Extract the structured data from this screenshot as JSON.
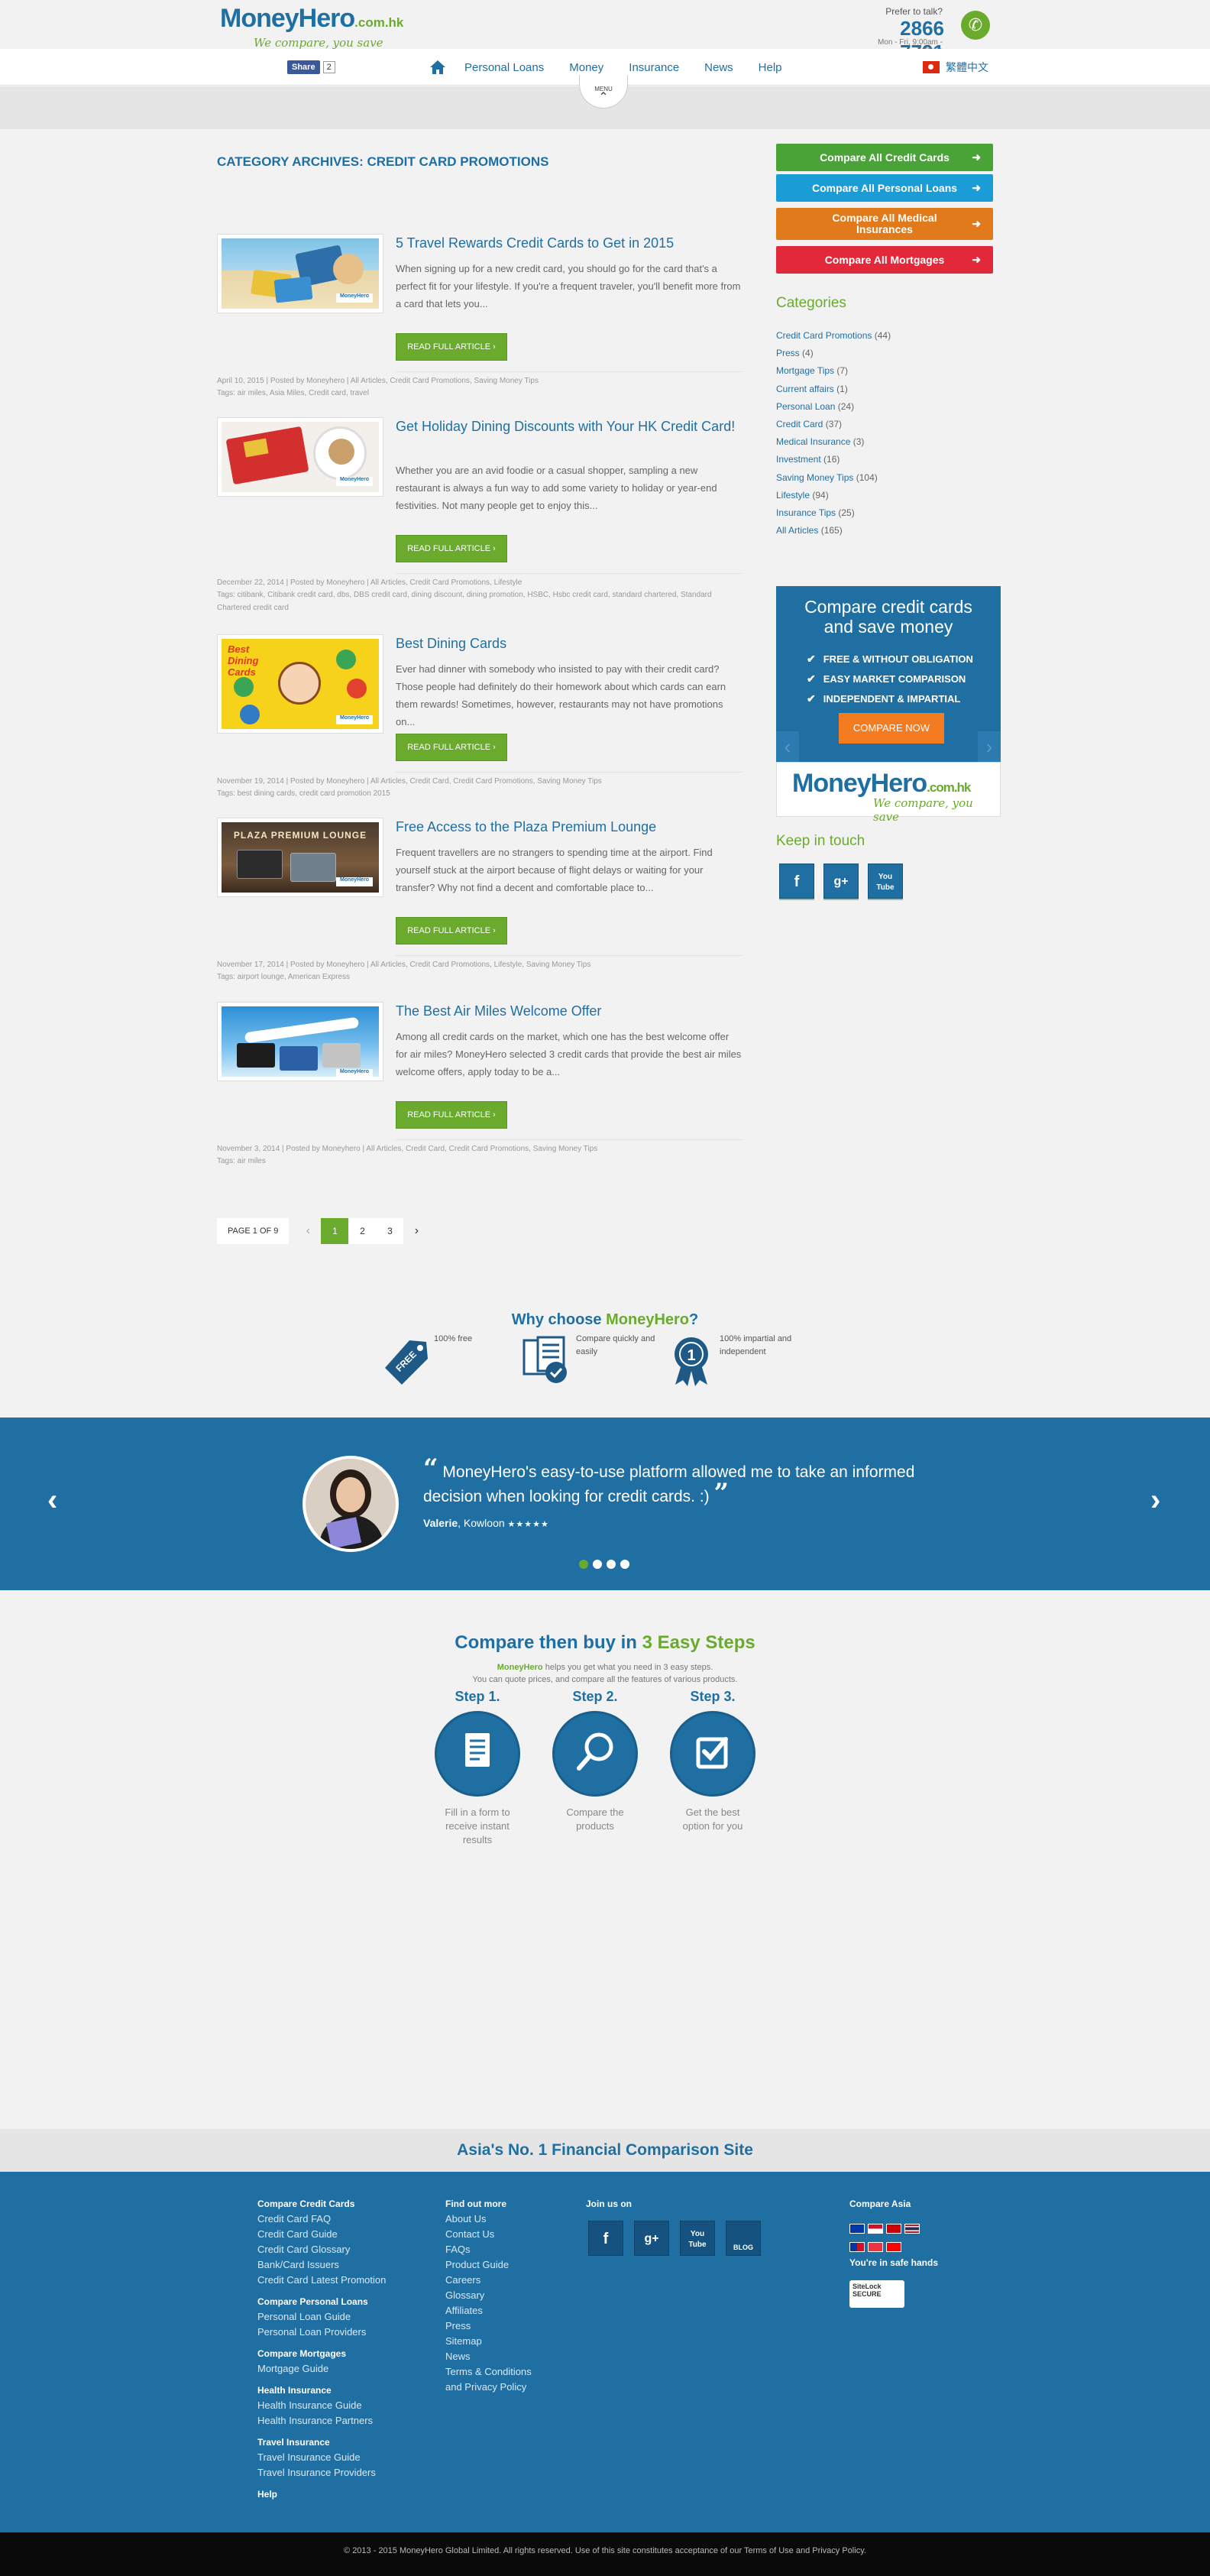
{
  "header": {
    "logo_main": "MoneyHero",
    "logo_domain": ".com.hk",
    "logo_tagline": "We compare, you save",
    "phone_prompt": "Prefer to talk?",
    "phone_number": "2866 7791",
    "phone_hours": "Mon - Fri, 9:00am - 7:00pm"
  },
  "nav": {
    "share_label": "Share",
    "share_count": "2",
    "items": [
      "Personal Loans",
      "Money",
      "Insurance",
      "News",
      "Help"
    ],
    "language": "繁體中文",
    "menu_tab": "MENU"
  },
  "main": {
    "archive_title": "CATEGORY ARCHIVES: CREDIT CARD PROMOTIONS",
    "read_more": "READ FULL ARTICLE",
    "posts": [
      {
        "title": "5 Travel Rewards Credit Cards to Get in 2015",
        "excerpt": "When signing up for a new credit card, you should go for the card that's a perfect fit for your lifestyle. If you're a frequent traveler, you'll benefit more from a card that lets you...",
        "meta": "April 10, 2015 | Posted by Moneyhero | All Articles, Credit Card Promotions, Saving Money Tips",
        "tags": "Tags: air miles, Asia Miles, Credit card, travel"
      },
      {
        "title": "Get Holiday Dining Discounts with Your HK Credit Card!",
        "excerpt": "Whether you are an avid foodie or a casual shopper, sampling a new restaurant is always a fun way to add some variety to holiday or year-end festivities. Not many people get to enjoy this...",
        "meta": "December 22, 2014 | Posted by Moneyhero | All Articles, Credit Card Promotions, Lifestyle",
        "tags": "Tags: citibank, Citibank credit card, dbs, DBS credit card, dining discount, dining promotion, HSBC, Hsbc credit card, standard chartered, Standard Chartered credit card"
      },
      {
        "title": "Best Dining Cards",
        "excerpt": "Ever had dinner with somebody who insisted to pay with their credit card? Those people had definitely do their homework about which cards can earn them rewards! Sometimes, however, restaurants may not have promotions on...",
        "meta": "November 19, 2014 | Posted by Moneyhero | All Articles, Credit Card, Credit Card Promotions, Saving Money Tips",
        "tags": "Tags: best dining cards, credit card promotion 2015"
      },
      {
        "title": "Free Access to the Plaza Premium Lounge",
        "excerpt": "Frequent travellers are no strangers to spending time at the airport.  Find yourself stuck at the airport because of flight delays or waiting for your transfer? Why not find a decent and comfortable place to...",
        "meta": "November 17, 2014 | Posted by Moneyhero | All Articles, Credit Card Promotions, Lifestyle, Saving Money Tips",
        "tags": "Tags: airport lounge, American Express"
      },
      {
        "title": "The Best Air Miles Welcome Offer",
        "excerpt": "Among all credit cards on the market, which one has the best welcome offer for air miles? MoneyHero selected 3 credit cards that provide the best air miles welcome offers, apply today to be a...",
        "meta": "November 3, 2014 | Posted by Moneyhero | All Articles, Credit Card, Credit Card Promotions, Saving Money Tips",
        "tags": "Tags: air miles"
      }
    ],
    "thumb_labels": [
      "Best Dining Cards",
      "PLAZA PREMIUM LOUNGE"
    ],
    "pagination": {
      "label": "PAGE 1 OF 9",
      "pages": [
        "1",
        "2",
        "3"
      ],
      "prev": "‹",
      "next": "›"
    }
  },
  "sidebar": {
    "cta": [
      {
        "label": "Compare All Credit Cards",
        "color": "#4aa337"
      },
      {
        "label": "Compare All Personal Loans",
        "color": "#1a9dd6"
      },
      {
        "label": "Compare All Medical Insurances",
        "color": "#e07a1a"
      },
      {
        "label": "Compare All Mortgages",
        "color": "#e2293b"
      }
    ],
    "categories_title": "Categories",
    "categories": [
      {
        "name": "Credit Card Promotions",
        "count": "(44)"
      },
      {
        "name": "Press",
        "count": "(4)"
      },
      {
        "name": "Mortgage Tips",
        "count": "(7)"
      },
      {
        "name": "Current affairs",
        "count": "(1)"
      },
      {
        "name": "Personal Loan",
        "count": "(24)"
      },
      {
        "name": "Credit Card",
        "count": "(37)"
      },
      {
        "name": "Medical Insurance",
        "count": "(3)"
      },
      {
        "name": "Investment",
        "count": "(16)"
      },
      {
        "name": "Saving Money Tips",
        "count": "(104)"
      },
      {
        "name": "Lifestyle",
        "count": "(94)"
      },
      {
        "name": "Insurance Tips",
        "count": "(25)"
      },
      {
        "name": "All Articles",
        "count": "(165)"
      }
    ],
    "promo": {
      "title_line1": "Compare credit cards",
      "title_line2": "and save money",
      "bullets": [
        "FREE & WITHOUT OBLIGATION",
        "EASY MARKET COMPARISON",
        "INDEPENDENT & IMPARTIAL"
      ],
      "button": "COMPARE NOW"
    },
    "keep_in_touch": "Keep in touch",
    "social": [
      "f",
      "g+",
      "You Tube"
    ]
  },
  "why": {
    "title_prefix": "Why choose ",
    "title_brand": "MoneyHero",
    "title_suffix": "?",
    "badge": "FREE",
    "items": [
      "100% free",
      "Compare quickly and easily",
      "100% impartial and independent"
    ],
    "medal": "1"
  },
  "testimonial": {
    "quote": "MoneyHero's easy-to-use platform allowed me to take an informed decision when looking for credit cards. :)",
    "open_quote": "“",
    "close_quote": "”",
    "name": "Valerie",
    "location": ", Kowloon",
    "stars": "★★★★★",
    "prev": "‹",
    "next": "›"
  },
  "steps": {
    "title_prefix": "Compare then buy in ",
    "title_highlight": "3 Easy Steps",
    "brand": "MoneyHero",
    "sub1": " helps you get what you need in 3 easy steps.",
    "sub2": "You can quote prices, and compare all the features of various products.",
    "items": [
      {
        "label": "Step 1.",
        "desc": "Fill in a form to receive instant results"
      },
      {
        "label": "Step 2.",
        "desc": "Compare the products"
      },
      {
        "label": "Step 3.",
        "desc": "Get the best option for you"
      }
    ]
  },
  "footer": {
    "tagline": "Asia's No. 1 Financial Comparison Site",
    "col1": [
      {
        "h": "Compare Credit Cards",
        "links": [
          "Credit Card FAQ",
          "Credit Card Guide",
          "Credit Card Glossary",
          "Bank/Card Issuers",
          "Credit Card Latest Promotion"
        ]
      },
      {
        "h": "Compare Personal Loans",
        "links": [
          "Personal Loan Guide",
          "Personal Loan Providers"
        ]
      },
      {
        "h": "Compare Mortgages",
        "links": [
          "Mortgage Guide"
        ]
      },
      {
        "h": "Health Insurance",
        "links": [
          "Health Insurance Guide",
          "Health Insurance Partners"
        ]
      },
      {
        "h": "Travel Insurance",
        "links": [
          "Travel Insurance Guide",
          "Travel Insurance Providers"
        ]
      },
      {
        "h": "Help",
        "links": []
      }
    ],
    "col2_title": "Find out more",
    "col2": [
      "About Us",
      "Contact Us",
      "FAQs",
      "Product Guide",
      "Careers",
      "Glossary",
      "Affiliates",
      "Press",
      "Sitemap",
      "News",
      "Terms & Conditions",
      "and Privacy Policy"
    ],
    "join_title": "Join us on",
    "join_icons": [
      "f",
      "g+",
      "You Tube",
      "BLOG"
    ],
    "asia_title": "Compare Asia",
    "safe": "You're in safe hands",
    "sitelock": "SiteLock SECURE",
    "copyright": "© 2013 - 2015 MoneyHero Global Limited. All rights reserved. Use of this site constitutes acceptance of our Terms of Use and Privacy Policy."
  }
}
